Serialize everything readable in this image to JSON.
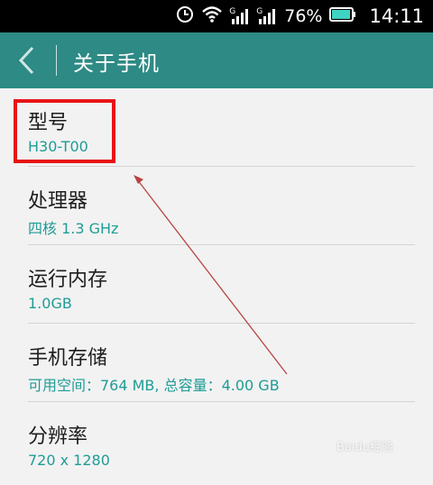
{
  "status_bar": {
    "battery": "76%",
    "time": "14:11",
    "signal_label": "G",
    "icons": [
      "alarm-icon",
      "wifi-icon",
      "signal-icon",
      "signal-icon",
      "battery-icon"
    ]
  },
  "app_bar": {
    "title": "关于手机",
    "color": "#2d8a84"
  },
  "items": [
    {
      "label": "型号",
      "value": "H30-T00"
    },
    {
      "label": "处理器",
      "value": "四核 1.3 GHz"
    },
    {
      "label": "运行内存",
      "value": "1.0GB"
    },
    {
      "label": "手机存储",
      "value": "可用空间：764 MB, 总容量：4.00 GB"
    },
    {
      "label": "分辨率",
      "value": "720 x 1280"
    }
  ],
  "watermark": "Baidu经验"
}
